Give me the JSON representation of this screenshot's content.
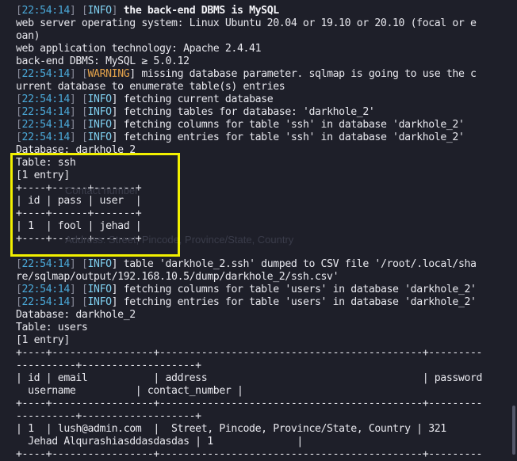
{
  "terminal": {
    "lines": [
      {
        "segments": [
          {
            "t": "[",
            "c": "g"
          },
          {
            "t": "22:54:14",
            "c": "ts"
          },
          {
            "t": "] [",
            "c": "g"
          },
          {
            "t": "INFO",
            "c": "info"
          },
          {
            "t": "] ",
            "c": "g"
          },
          {
            "t": "the back-end DBMS is MySQL",
            "c": "b"
          }
        ]
      },
      {
        "segments": [
          {
            "t": "web server operating system: Linux Ubuntu 20.04 or 19.10 or 20.10 (focal or e",
            "c": ""
          }
        ]
      },
      {
        "segments": [
          {
            "t": "oan)",
            "c": ""
          }
        ]
      },
      {
        "segments": [
          {
            "t": "web application technology: Apache 2.4.41",
            "c": ""
          }
        ]
      },
      {
        "segments": [
          {
            "t": "back-end DBMS: MySQL ≥ 5.0.12",
            "c": ""
          }
        ]
      },
      {
        "segments": [
          {
            "t": "[",
            "c": "g"
          },
          {
            "t": "22:54:14",
            "c": "ts"
          },
          {
            "t": "] [",
            "c": "g"
          },
          {
            "t": "WARNING",
            "c": "warn"
          },
          {
            "t": "] missing database parameter. sqlmap is going to use the c",
            "c": ""
          }
        ]
      },
      {
        "segments": [
          {
            "t": "urrent database to enumerate table(s) entries",
            "c": ""
          }
        ]
      },
      {
        "segments": [
          {
            "t": "[",
            "c": "g"
          },
          {
            "t": "22:54:14",
            "c": "ts"
          },
          {
            "t": "] [",
            "c": "g"
          },
          {
            "t": "INFO",
            "c": "info"
          },
          {
            "t": "] fetching current database",
            "c": ""
          }
        ]
      },
      {
        "segments": [
          {
            "t": "[",
            "c": "g"
          },
          {
            "t": "22:54:14",
            "c": "ts"
          },
          {
            "t": "] [",
            "c": "g"
          },
          {
            "t": "INFO",
            "c": "info"
          },
          {
            "t": "] fetching tables for database: 'darkhole_2'",
            "c": ""
          }
        ]
      },
      {
        "segments": [
          {
            "t": "[",
            "c": "g"
          },
          {
            "t": "22:54:14",
            "c": "ts"
          },
          {
            "t": "] [",
            "c": "g"
          },
          {
            "t": "INFO",
            "c": "info"
          },
          {
            "t": "] fetching columns for table 'ssh' in database 'darkhole_2'",
            "c": ""
          }
        ]
      },
      {
        "segments": [
          {
            "t": "[",
            "c": "g"
          },
          {
            "t": "22:54:14",
            "c": "ts"
          },
          {
            "t": "] [",
            "c": "g"
          },
          {
            "t": "INFO",
            "c": "info"
          },
          {
            "t": "] fetching entries for table 'ssh' in database 'darkhole_2'",
            "c": ""
          }
        ]
      },
      {
        "segments": [
          {
            "t": "Database: darkhole_2",
            "c": ""
          }
        ]
      },
      {
        "segments": [
          {
            "t": "Table: ssh",
            "c": ""
          }
        ]
      },
      {
        "segments": [
          {
            "t": "[1 entry]",
            "c": ""
          }
        ]
      },
      {
        "segments": [
          {
            "t": "+----+------+-------+",
            "c": ""
          }
        ]
      },
      {
        "segments": [
          {
            "t": "| id | pass | user  |",
            "c": ""
          }
        ]
      },
      {
        "segments": [
          {
            "t": "+----+------+-------+",
            "c": ""
          }
        ]
      },
      {
        "segments": [
          {
            "t": "| 1  | fool | jehad |",
            "c": ""
          }
        ]
      },
      {
        "segments": [
          {
            "t": "+----+------+-------+",
            "c": ""
          }
        ]
      },
      {
        "segments": [
          {
            "t": "",
            "c": ""
          }
        ]
      },
      {
        "segments": [
          {
            "t": "[",
            "c": "g"
          },
          {
            "t": "22:54:14",
            "c": "ts"
          },
          {
            "t": "] [",
            "c": "g"
          },
          {
            "t": "INFO",
            "c": "info"
          },
          {
            "t": "] table 'darkhole_2.ssh' dumped to CSV file '/root/.local/sha",
            "c": ""
          }
        ]
      },
      {
        "segments": [
          {
            "t": "re/sqlmap/output/192.168.10.5/dump/darkhole_2/ssh.csv'",
            "c": ""
          }
        ]
      },
      {
        "segments": [
          {
            "t": "[",
            "c": "g"
          },
          {
            "t": "22:54:14",
            "c": "ts"
          },
          {
            "t": "] [",
            "c": "g"
          },
          {
            "t": "INFO",
            "c": "info"
          },
          {
            "t": "] fetching columns for table 'users' in database 'darkhole_2'",
            "c": ""
          }
        ]
      },
      {
        "segments": [
          {
            "t": "[",
            "c": "g"
          },
          {
            "t": "22:54:14",
            "c": "ts"
          },
          {
            "t": "] [",
            "c": "g"
          },
          {
            "t": "INFO",
            "c": "info"
          },
          {
            "t": "] fetching entries for table 'users' in database 'darkhole_2'",
            "c": ""
          }
        ]
      },
      {
        "segments": [
          {
            "t": "Database: darkhole_2",
            "c": ""
          }
        ]
      },
      {
        "segments": [
          {
            "t": "Table: users",
            "c": ""
          }
        ]
      },
      {
        "segments": [
          {
            "t": "[1 entry]",
            "c": ""
          }
        ]
      },
      {
        "segments": [
          {
            "t": "+----+-----------------+--------------------------------------------+---------",
            "c": ""
          }
        ]
      },
      {
        "segments": [
          {
            "t": "----------+-------------------+",
            "c": ""
          }
        ]
      },
      {
        "segments": [
          {
            "t": "| id | email           | address                                    | password",
            "c": ""
          }
        ]
      },
      {
        "segments": [
          {
            "t": "  username          | contact_number |",
            "c": ""
          }
        ]
      },
      {
        "segments": [
          {
            "t": "+----+-----------------+--------------------------------------------+---------",
            "c": ""
          }
        ]
      },
      {
        "segments": [
          {
            "t": "----------+-------------------+",
            "c": ""
          }
        ]
      },
      {
        "segments": [
          {
            "t": "| 1  | lush@admin.com  |  Street, Pincode, Province/State, Country | 321",
            "c": ""
          }
        ]
      },
      {
        "segments": [
          {
            "t": "  Jehad Alqurashiasddasdasdas | 1              |",
            "c": ""
          }
        ]
      },
      {
        "segments": [
          {
            "t": "+----+-----------------+--------------------------------------------+---------",
            "c": ""
          }
        ]
      }
    ],
    "ghost": {
      "contact": "Contact number",
      "address": "Address: Street, Pincode, Province/State, Country"
    }
  }
}
